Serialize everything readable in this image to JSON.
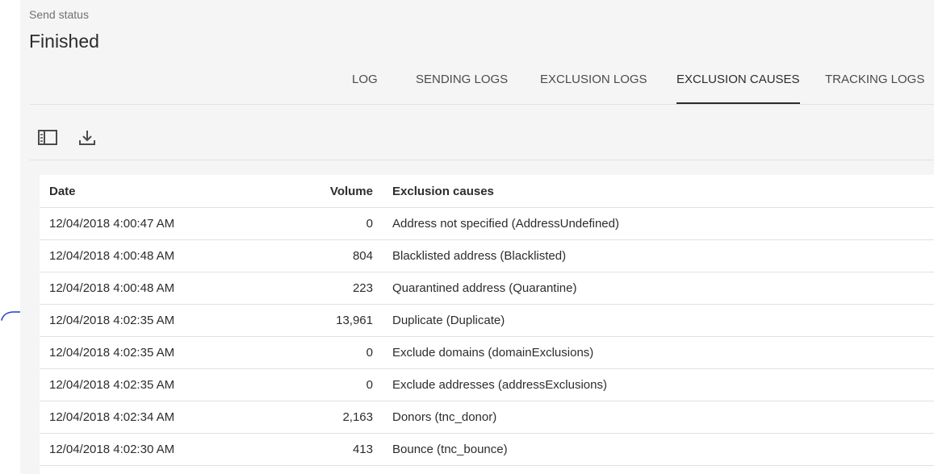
{
  "status": {
    "label": "Send status",
    "value": "Finished"
  },
  "tabs": [
    {
      "label": "LOG",
      "active": false
    },
    {
      "label": "SENDING LOGS",
      "active": false
    },
    {
      "label": "EXCLUSION LOGS",
      "active": false
    },
    {
      "label": "EXCLUSION CAUSES",
      "active": true
    },
    {
      "label": "TRACKING LOGS",
      "active": false
    }
  ],
  "toolbar": {
    "panel_toggle_icon": "sidebar-panel-icon",
    "download_icon": "download-icon"
  },
  "table": {
    "headers": {
      "date": "Date",
      "volume": "Volume",
      "causes": "Exclusion causes"
    },
    "rows": [
      {
        "date": "12/04/2018 4:00:47 AM",
        "volume": "0",
        "cause": "Address not specified (AddressUndefined)"
      },
      {
        "date": "12/04/2018 4:00:48 AM",
        "volume": "804",
        "cause": "Blacklisted address (Blacklisted)"
      },
      {
        "date": "12/04/2018 4:00:48 AM",
        "volume": "223",
        "cause": "Quarantined address (Quarantine)"
      },
      {
        "date": "12/04/2018 4:02:35 AM",
        "volume": "13,961",
        "cause": "Duplicate (Duplicate)"
      },
      {
        "date": "12/04/2018 4:02:35 AM",
        "volume": "0",
        "cause": "Exclude domains (domainExclusions)"
      },
      {
        "date": "12/04/2018 4:02:35 AM",
        "volume": "0",
        "cause": "Exclude addresses (addressExclusions)"
      },
      {
        "date": "12/04/2018 4:02:34 AM",
        "volume": "2,163",
        "cause": "Donors (tnc_donor)"
      },
      {
        "date": "12/04/2018 4:02:30 AM",
        "volume": "413",
        "cause": "Bounce (tnc_bounce)"
      }
    ]
  },
  "colors": {
    "panel_bg": "#f5f5f5",
    "annotation_ink": "#1f3fd0",
    "divider": "#e1e1e1"
  }
}
